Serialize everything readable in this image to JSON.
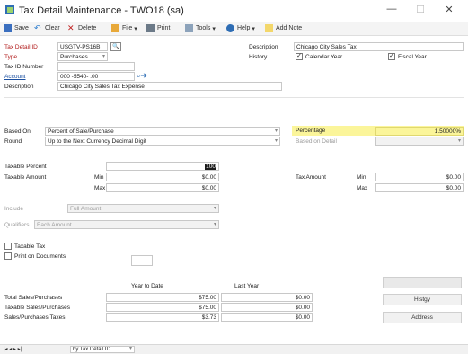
{
  "window": {
    "title": "Tax Detail Maintenance  -  TWO18 (sa)",
    "minimize": "—",
    "maximize": "☐",
    "close": "✕"
  },
  "toolbar": {
    "save": "Save",
    "clear": "Clear",
    "delete": "Delete",
    "file": "File",
    "print": "Print",
    "tools": "Tools",
    "help": "Help",
    "add_note": "Add Note"
  },
  "form": {
    "tax_detail_id_label": "Tax Detail ID",
    "tax_detail_id": "USGTV-PS16B",
    "type_label": "Type",
    "type": "Purchases",
    "tax_id_label": "Tax ID Number",
    "tax_id": "",
    "account_label": "Account",
    "account": "000 -5540- .00",
    "description_label": "Description",
    "description": "Chicago City Sales Tax Expense",
    "right_description_label": "Description",
    "right_description": "Chicago City Sales Tax",
    "history_label": "History",
    "calendar_year": "Calendar Year",
    "fiscal_year": "Fiscal Year",
    "based_on_label": "Based On",
    "based_on": "Percent of Sale/Purchase",
    "round_label": "Round",
    "round": "Up to the Next Currency Decimal Digit",
    "percentage_label": "Percentage",
    "percentage": "1.50000%",
    "based_on_detail_label": "Based on Detail",
    "based_on_detail": "",
    "taxable_percent_label": "Taxable Percent",
    "taxable_percent": "100",
    "taxable_amount_label": "Taxable Amount",
    "min_label": "Min",
    "min": "$0.00",
    "max_label": "Max",
    "max": "$0.00",
    "tax_amount_label": "Tax Amount",
    "tax_min_label": "Min",
    "tax_min": "$0.00",
    "tax_max_label": "Max",
    "tax_max": "$0.00",
    "include_label": "Include",
    "include": "Full Amount",
    "qualifiers_label": "Qualifiers",
    "qualifiers": "Each Amount",
    "taxable_tax_label": "Taxable Tax",
    "print_docs_label": "Print on Documents",
    "print_docs_value": ""
  },
  "summary": {
    "col_ytd": "Year to Date",
    "col_last": "Last Year",
    "rows": [
      {
        "label": "Total Sales/Purchases",
        "ytd": "$75.00",
        "last": "$0.00"
      },
      {
        "label": "Taxable Sales/Purchases",
        "ytd": "$75.00",
        "last": "$0.00"
      },
      {
        "label": "Sales/Purchases Taxes",
        "ytd": "$3.73",
        "last": "$0.00"
      }
    ]
  },
  "buttons": {
    "top": "",
    "history": "Histgy",
    "address": "Address"
  },
  "status": {
    "nav": "|◂  ◂  ▸  ▸|",
    "sort": "by Tax Detail ID"
  },
  "colors": {
    "accent": "#2e6db4",
    "required": "#b01818",
    "highlight": "#fbf59a"
  }
}
